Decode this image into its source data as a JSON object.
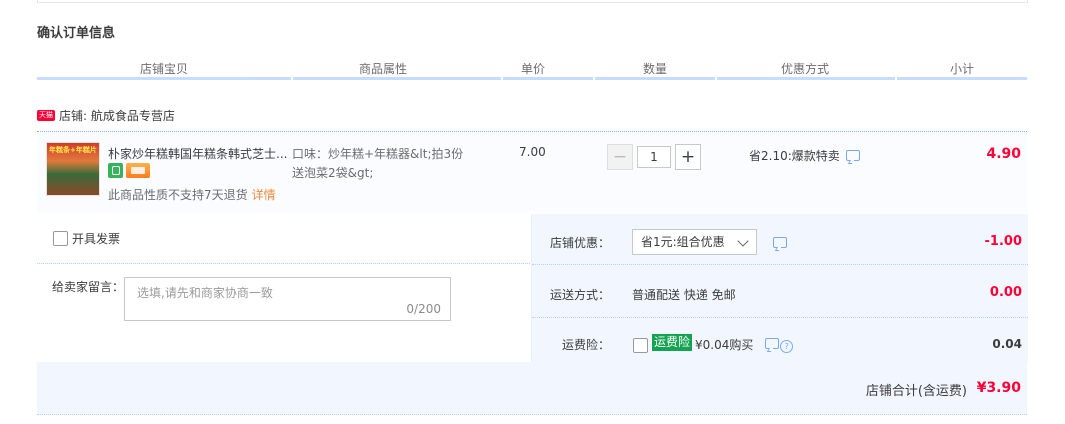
{
  "page_title": "确认订单信息",
  "columns": [
    "店铺宝贝",
    "商品属性",
    "单价",
    "数量",
    "优惠方式",
    "小计"
  ],
  "shop": {
    "badge": "天猫",
    "label": "店铺: 航成食品专营店"
  },
  "item": {
    "thumb_text": "年糕条+年糕片",
    "title": "朴家炒年糕韩国年糕条韩式芝士...",
    "attribute": "口味：炒年糕+年糕器&lt;拍3份送泡菜2袋&gt;",
    "no_return": "此商品性质不支持7天退货",
    "details_link": "详情",
    "unit_price": "7.00",
    "qty_minus": "−",
    "quantity": "1",
    "qty_plus": "+",
    "discount": "省2.10:爆款特卖",
    "subtotal": "4.90"
  },
  "invoice_label": "开具发票",
  "message": {
    "label": "给卖家留言：",
    "placeholder": "选填,请先和商家协商一致",
    "counter": "0/200"
  },
  "shop_discount": {
    "label": "店铺优惠：",
    "selected": "省1元:组合优惠",
    "value": "-1.00"
  },
  "shipping": {
    "label": "运送方式：",
    "method": "普通配送 快递 免邮",
    "value": "0.00"
  },
  "insurance": {
    "label": "运费险：",
    "tag": "运费险",
    "text": "¥0.04购买",
    "value": "0.04"
  },
  "total": {
    "label": "店铺合计(含运费)",
    "value": "¥3.90"
  },
  "colors": {
    "accent_red": "#ff0036",
    "light_blue_bg": "#f2f7ff",
    "link_orange": "#f08a3c",
    "insurance_green": "#14a350"
  }
}
